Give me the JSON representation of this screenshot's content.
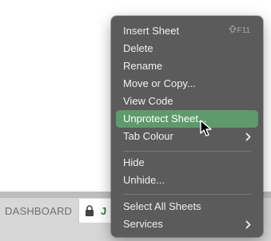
{
  "menu": {
    "items": [
      {
        "label": "Insert Sheet",
        "shortcut": "F11"
      },
      {
        "label": "Delete"
      },
      {
        "label": "Rename"
      },
      {
        "label": "Move or Copy..."
      },
      {
        "label": "View Code"
      },
      {
        "label": "Unprotect Sheet..."
      },
      {
        "label": "Tab Colour"
      },
      {
        "label": "Hide"
      },
      {
        "label": "Unhide..."
      },
      {
        "label": "Select All Sheets"
      },
      {
        "label": "Services"
      }
    ],
    "highlighted_item": "Unprotect Sheet...",
    "colors": {
      "background": "#5b5b5b",
      "highlight": "#5e9a6b",
      "text": "#f0f0f0"
    }
  },
  "tabs": {
    "dashboard_label": "DASHBOARD",
    "active_label": "J",
    "active_color": "#2f7d32"
  }
}
